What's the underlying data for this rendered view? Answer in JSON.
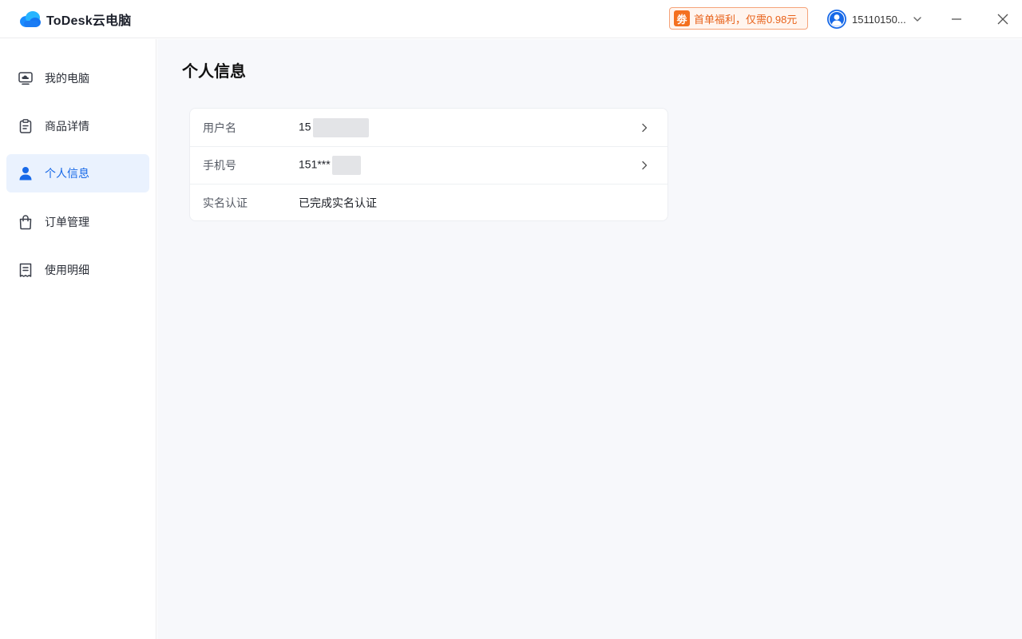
{
  "app": {
    "name": "ToDesk云电脑"
  },
  "promo": {
    "badge": "劵",
    "text": "首单福利，仅需0.98元"
  },
  "user": {
    "name": "15110150..."
  },
  "sidebar": {
    "items": [
      {
        "label": "我的电脑",
        "icon": "computer-icon"
      },
      {
        "label": "商品详情",
        "icon": "clipboard-icon"
      },
      {
        "label": "个人信息",
        "icon": "user-icon"
      },
      {
        "label": "订单管理",
        "icon": "shopping-bag-icon"
      },
      {
        "label": "使用明细",
        "icon": "receipt-icon"
      }
    ],
    "active_index": 2
  },
  "main": {
    "title": "个人信息",
    "rows": [
      {
        "label": "用户名",
        "value": "15"
      },
      {
        "label": "手机号",
        "value": "151***"
      },
      {
        "label": "实名认证",
        "value": "已完成实名认证"
      }
    ]
  },
  "colors": {
    "accent": "#1769e8",
    "active_bg": "#eaf2fe",
    "promo_orange": "#f4701f"
  }
}
